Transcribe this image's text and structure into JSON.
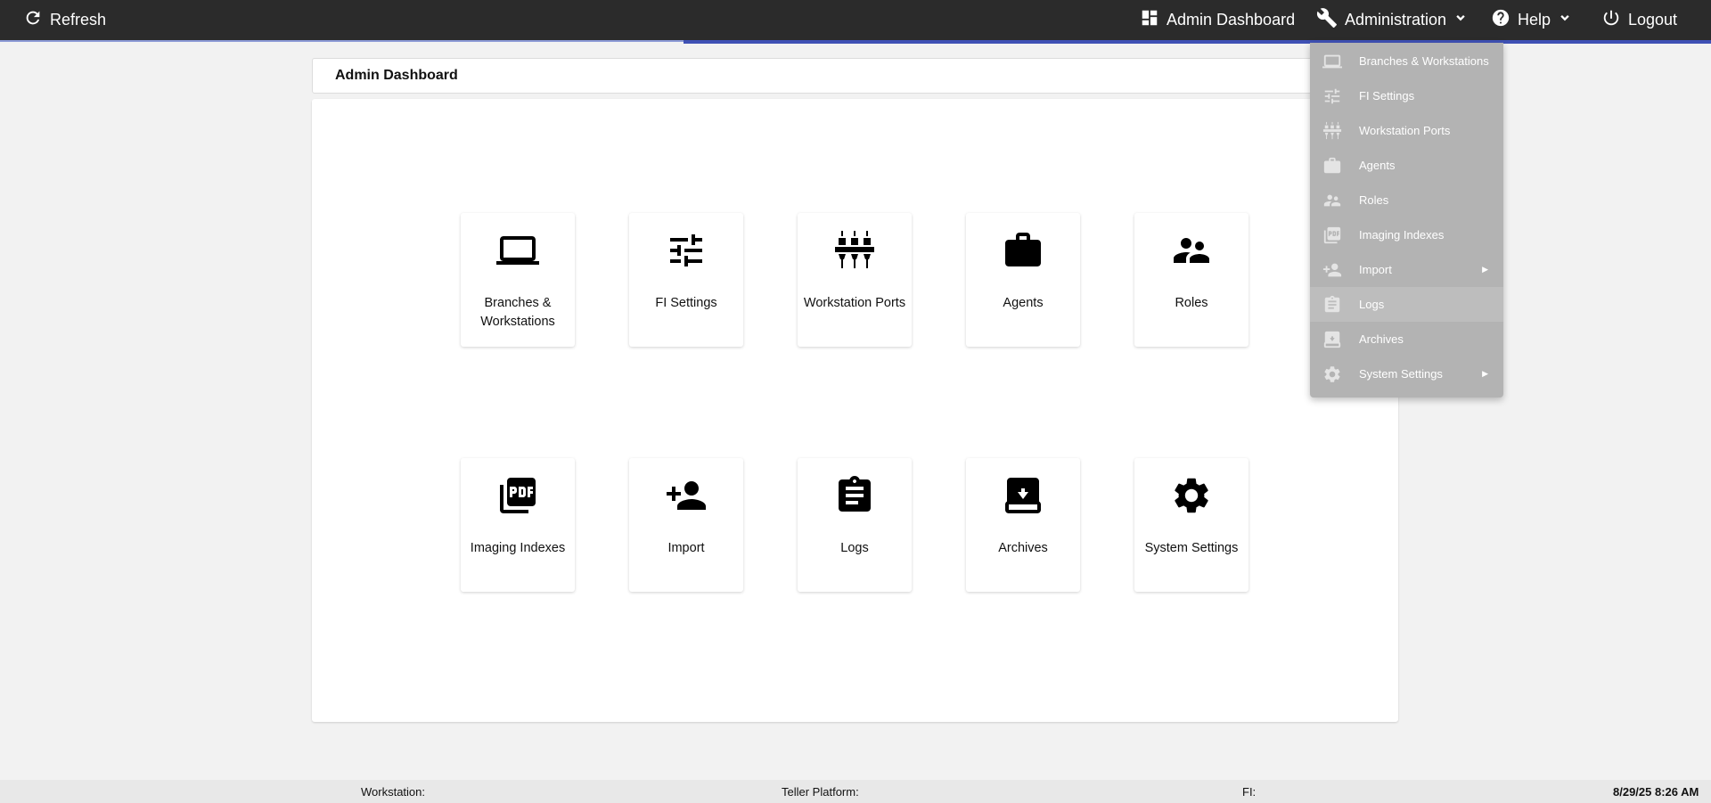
{
  "topbar": {
    "refresh_label": "Refresh",
    "admin_dashboard_label": "Admin Dashboard",
    "administration_label": "Administration",
    "help_label": "Help",
    "logout_label": "Logout",
    "accent_color": "#3f51b5"
  },
  "page": {
    "title": "Admin Dashboard"
  },
  "tiles": [
    {
      "label": "Branches & Workstations",
      "icon": "laptop-icon"
    },
    {
      "label": "FI Settings",
      "icon": "tune-icon"
    },
    {
      "label": "Workstation Ports",
      "icon": "ports-icon"
    },
    {
      "label": "Agents",
      "icon": "briefcase-icon"
    },
    {
      "label": "Roles",
      "icon": "people-icon"
    },
    {
      "label": "Imaging Indexes",
      "icon": "pdf-icon"
    },
    {
      "label": "Import",
      "icon": "add-person-icon"
    },
    {
      "label": "Logs",
      "icon": "clipboard-icon"
    },
    {
      "label": "Archives",
      "icon": "archive-icon"
    },
    {
      "label": "System Settings",
      "icon": "gear-icon"
    }
  ],
  "administration_menu": {
    "items": [
      {
        "label": "Branches & Workstations",
        "icon": "laptop-icon"
      },
      {
        "label": "FI Settings",
        "icon": "tune-icon"
      },
      {
        "label": "Workstation Ports",
        "icon": "ports-icon"
      },
      {
        "label": "Agents",
        "icon": "briefcase-icon"
      },
      {
        "label": "Roles",
        "icon": "people-icon"
      },
      {
        "label": "Imaging Indexes",
        "icon": "pdf-icon"
      },
      {
        "label": "Import",
        "icon": "add-person-icon",
        "submenu": true
      },
      {
        "label": "Logs",
        "icon": "clipboard-icon",
        "highlighted": true
      },
      {
        "label": "Archives",
        "icon": "archive-icon"
      },
      {
        "label": "System Settings",
        "icon": "gear-icon",
        "submenu": true
      }
    ]
  },
  "footer": {
    "workstation_label": "Workstation:",
    "teller_platform_label": "Teller Platform:",
    "fi_label": "FI:",
    "datetime": "8/29/25 8:26 AM"
  }
}
